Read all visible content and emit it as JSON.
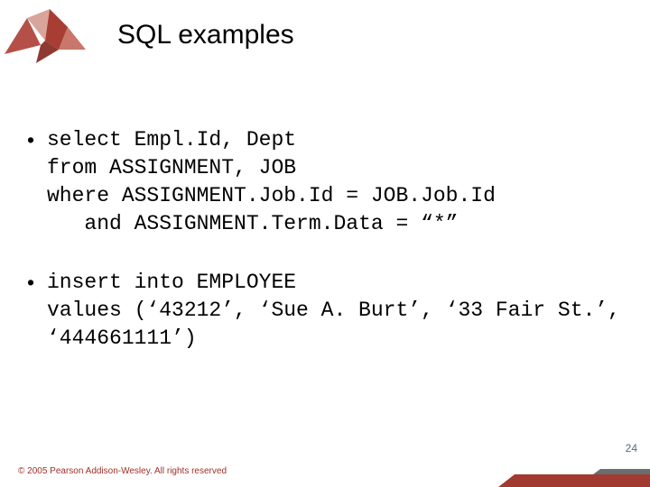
{
  "title": "SQL examples",
  "bullets": [
    "select Empl.Id, Dept\nfrom ASSIGNMENT, JOB\nwhere ASSIGNMENT.Job.Id = JOB.Job.Id\n   and ASSIGNMENT.Term.Data = “*”",
    "insert into EMPLOYEE\nvalues (‘43212’, ‘Sue A. Burt’, ‘33 Fair St.’, ‘444661111’)"
  ],
  "footer": "© 2005 Pearson Addison-Wesley. All rights reserved",
  "page_number": "24",
  "logo_alt": "origami crane logo"
}
